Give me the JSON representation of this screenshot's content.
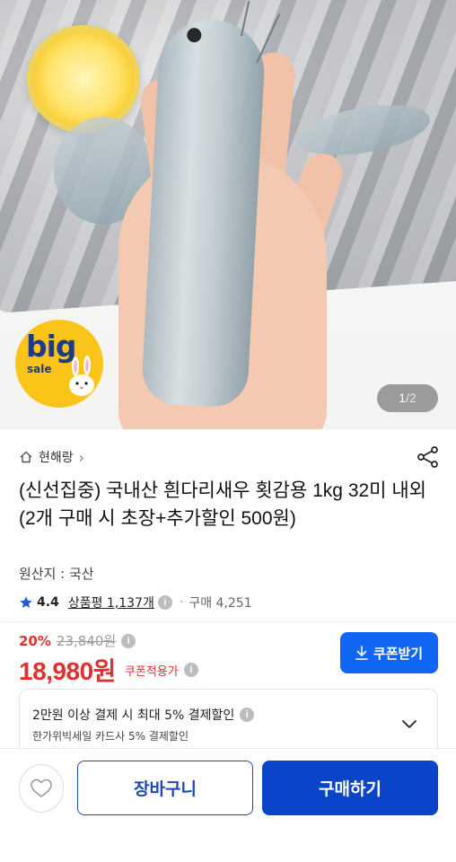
{
  "hero": {
    "badge_big": "big",
    "badge_sale": "sale",
    "pager_current": "1",
    "pager_separator": "/",
    "pager_total": "2"
  },
  "store": {
    "name": "현해랑",
    "chevron": "›"
  },
  "product": {
    "title": "(신선집중) 국내산 흰다리새우 횟감용 1kg 32미 내외 (2개 구매 시 초장+추가할인 500원)",
    "origin": "원산지 : 국산"
  },
  "rating": {
    "score": "4.4",
    "review_label": "상품평 1,137개",
    "buy_label": "구매 4,251",
    "info": "i",
    "separator": "·"
  },
  "price": {
    "discount_rate": "20%",
    "original": "23,840원",
    "final": "18,980원",
    "coupon_note": "쿠폰적용가",
    "info": "i"
  },
  "coupon_button": {
    "label": "쿠폰받기"
  },
  "promo": {
    "line1": "2만원 이상 결제 시 최대  5% 결제할인",
    "line2": "한가위빅세일  카드사 5% 결제할인",
    "info": "i"
  },
  "bottom": {
    "cart_label": "장바구니",
    "buy_label": "구매하기"
  },
  "colors": {
    "price_red": "#e03131",
    "coupon_blue": "#1167f4",
    "buy_blue": "#0a45c9",
    "cart_border": "#1e48b8",
    "badge_yellow": "#fbc418",
    "badge_text": "#1e3a8a",
    "star_blue": "#1f5fd6"
  },
  "icons": {
    "home": "home-icon",
    "share": "share-icon",
    "star": "star-icon",
    "download": "download-icon",
    "chevron_down": "chevron-down-icon",
    "heart": "heart-icon"
  }
}
